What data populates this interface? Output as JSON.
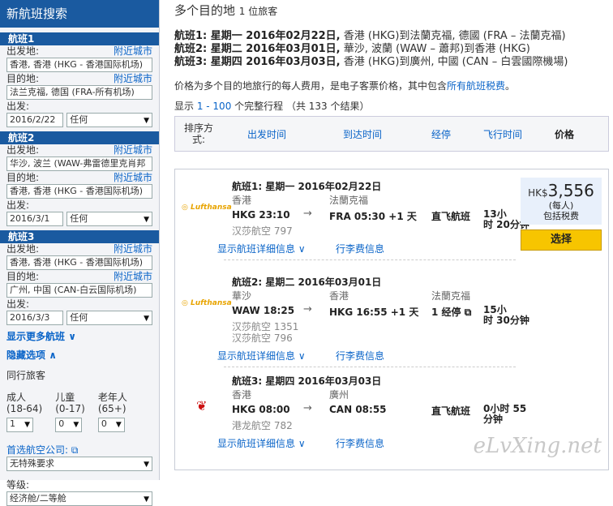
{
  "sidebar": {
    "title": "新航班搜索",
    "nearby": "附近城市",
    "depart_label": "出发地:",
    "dest_label": "目的地:",
    "date_label": "出发:",
    "flights": [
      {
        "title": "航班1",
        "from": "香港, 香港 (HKG - 香港国际机场)",
        "to": "法兰克福, 德国 (FRA-所有机场)",
        "date": "2016/2/22",
        "time": "任何"
      },
      {
        "title": "航班2",
        "from": "华沙, 波兰 (WAW-弗雷德里克肖邦",
        "to": "香港, 香港 (HKG - 香港国际机场)",
        "date": "2016/3/1",
        "time": "任何"
      },
      {
        "title": "航班3",
        "from": "香港, 香港 (HKG - 香港国际机场)",
        "to": "广州, 中国 (CAN-白云国际机场)",
        "date": "2016/3/3",
        "time": "任何"
      }
    ],
    "more_flights": "显示更多航班",
    "hide_options": "隐藏选项",
    "travelers_label": "同行旅客",
    "adult": "成人",
    "adult_range": "(18-64)",
    "adult_val": "1",
    "child": "儿童",
    "child_range": "(0-17)",
    "child_val": "0",
    "senior": "老年人",
    "senior_range": "(65+)",
    "senior_val": "0",
    "airline_label": "首选航空公司:",
    "airline_val": "无特殊要求",
    "class_label": "等级:",
    "class_val": "经济舱/二等舱"
  },
  "main": {
    "title": "多个目的地",
    "title_small": "1 位旅客",
    "leg_lines": [
      {
        "head": "航班1: 星期一 2016年02月22日,",
        "rest": " 香港 (HKG)到法蘭克福, 德國 (FRA – 法蘭克福)"
      },
      {
        "head": "航班2: 星期二 2016年03月01日,",
        "rest": " 華沙, 波蘭 (WAW – 蕭邦)到香港 (HKG)"
      },
      {
        "head": "航班3: 星期四 2016年03月03日,",
        "rest": " 香港 (HKG)到廣州, 中國 (CAN – 白雲國際機場)"
      }
    ],
    "note_pre": "价格为多个目的地旅行的每人费用，是电子客票价格，其中包含",
    "note_link": "所有航班税费",
    "note_post": "。",
    "count_pre": "显示 ",
    "count_link": "1 - 100",
    "count_post": " 个完整行程 （共 133 个结果）",
    "sort_label": "排序方式:",
    "sort": [
      "出发时间",
      "到达时间",
      "经停",
      "飞行时间",
      "价格"
    ]
  },
  "result": {
    "currency": "HK$",
    "amount": "3,556",
    "per": "(每人)",
    "tax": "包括税费",
    "select": "选择",
    "details": "显示航班详细信息",
    "baggage": "行李费信息",
    "legs": [
      {
        "airline": "Lufthansa",
        "title": "航班1: 星期一 2016年02月22日",
        "from_city": "香港",
        "dep": "HKG 23:10",
        "to_city": "法蘭克福",
        "arr": "FRA 05:30 +1 天",
        "type": "直飞航班",
        "dur1": "13小",
        "dur2": "时 20分钟",
        "carrier1": "汉莎航空 797",
        "carrier2": ""
      },
      {
        "airline": "Lufthansa",
        "title": "航班2: 星期二 2016年03月01日",
        "from_city": "華沙",
        "dep": "WAW 18:25",
        "to_city": "香港",
        "arr": "HKG 16:55 +1 天",
        "via": "法蘭克福",
        "type": "1 经停",
        "dur1": "15小",
        "dur2": "时 30分钟",
        "carrier1": "汉莎航空 1351",
        "carrier2": "汉莎航空 796"
      },
      {
        "airline": "Dragonair",
        "title": "航班3: 星期四 2016年03月03日",
        "from_city": "香港",
        "dep": "HKG 08:00",
        "to_city": "廣州",
        "arr": "CAN 08:55",
        "type": "直飞航班",
        "dur1": "0小时 55",
        "dur2": "分钟",
        "carrier1": "港龙航空 782",
        "carrier2": ""
      }
    ]
  },
  "watermark": "eLvXing.net"
}
